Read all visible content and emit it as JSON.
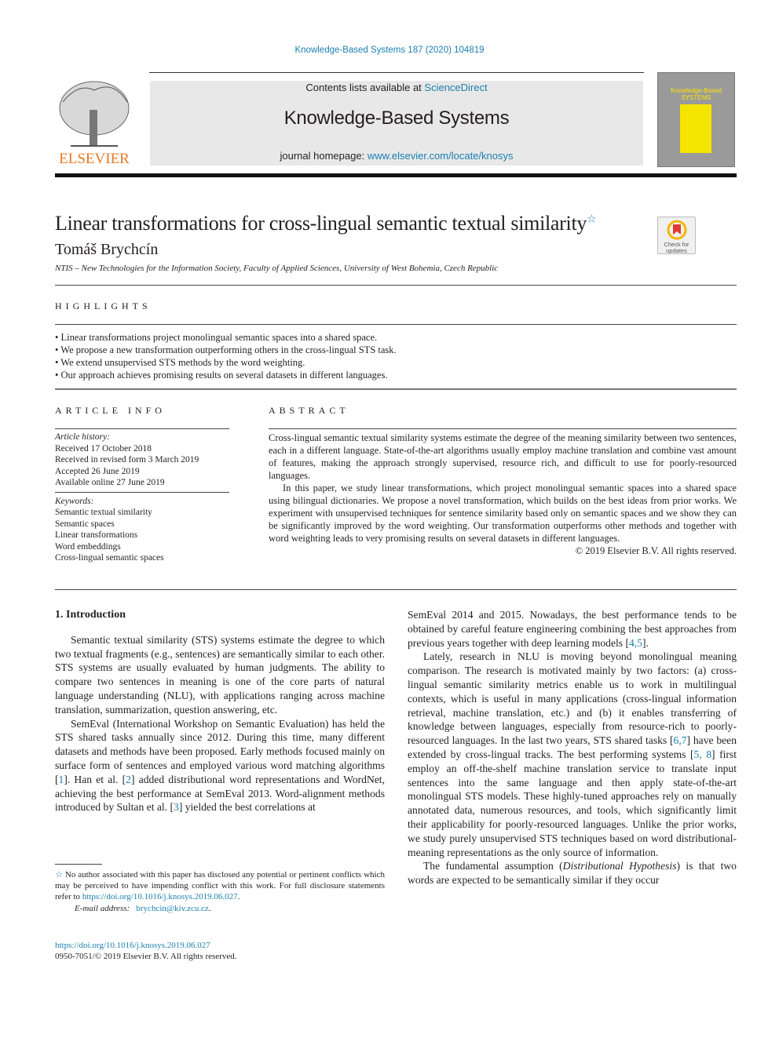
{
  "running_head": "Knowledge-Based Systems 187 (2020) 104819",
  "banner": {
    "contents_prefix": "Contents lists available at ",
    "contents_link": "ScienceDirect",
    "journal_title": "Knowledge-Based Systems",
    "homepage_prefix": "journal homepage: ",
    "homepage_link": "www.elsevier.com/locate/knosys",
    "publisher_logo": "ELSEVIER",
    "cover_title": "Knowledge-Based",
    "cover_subtitle": "SYSTEMS"
  },
  "article": {
    "title": "Linear transformations for cross-lingual semantic textual similarity",
    "title_mark": "☆",
    "author": "Tomáš Brychcín",
    "affiliation": "NTIS – New Technologies for the Information Society, Faculty of Applied Sciences, University of West Bohemia, Czech Republic",
    "check_updates": "Check for updates"
  },
  "highlights": {
    "heading": "HIGHLIGHTS",
    "items": [
      "Linear transformations project monolingual semantic spaces into a shared space.",
      "We propose a new transformation outperforming others in the cross-lingual STS task.",
      "We extend unsupervised STS methods by the word weighting.",
      "Our approach achieves promising results on several datasets in different languages."
    ]
  },
  "article_info": {
    "heading": "ARTICLE INFO",
    "history_label": "Article history:",
    "history": [
      "Received 17 October 2018",
      "Received in revised form 3 March 2019",
      "Accepted 26 June 2019",
      "Available online 27 June 2019"
    ],
    "keywords_label": "Keywords:",
    "keywords": [
      "Semantic textual similarity",
      "Semantic spaces",
      "Linear transformations",
      "Word embeddings",
      "Cross-lingual semantic spaces"
    ]
  },
  "abstract": {
    "heading": "ABSTRACT",
    "p1": "Cross-lingual semantic textual similarity systems estimate the degree of the meaning similarity between two sentences, each in a different language. State-of-the-art algorithms usually employ machine translation and combine vast amount of features, making the approach strongly supervised, resource rich, and difficult to use for poorly-resourced languages.",
    "p2": "In this paper, we study linear transformations, which project monolingual semantic spaces into a shared space using bilingual dictionaries. We propose a novel transformation, which builds on the best ideas from prior works. We experiment with unsupervised techniques for sentence similarity based only on semantic spaces and we show they can be significantly improved by the word weighting. Our transformation outperforms other methods and together with word weighting leads to very promising results on several datasets in different languages.",
    "copyright": "© 2019 Elsevier B.V. All rights reserved."
  },
  "intro": {
    "heading": "1.  Introduction",
    "left_p1": "Semantic textual similarity (STS) systems estimate the degree to which two textual fragments (e.g., sentences) are semantically similar to each other. STS systems are usually evaluated by human judgments. The ability to compare two sentences in meaning is one of the core parts of natural language understanding (NLU), with applications ranging across machine translation, summarization, question answering, etc.",
    "left_p2a": "SemEval (International Workshop on Semantic Evaluation) has held the STS shared tasks annually since 2012. During this time, many different datasets and methods have been proposed. Early methods focused mainly on surface form of sentences and employed various word matching algorithms [",
    "ref1": "1",
    "left_p2b": "]. Han et al. [",
    "ref2": "2",
    "left_p2c": "] added distributional word representations and WordNet, achieving the best performance at SemEval 2013. Word-alignment methods introduced by Sultan et al. [",
    "ref3": "3",
    "left_p2d": "] yielded the best correlations at",
    "right_p1a": "SemEval 2014 and 2015. Nowadays, the best performance tends to be obtained by careful feature engineering combining the best approaches from previous years together with deep learning models [",
    "ref45": "4,5",
    "right_p1b": "].",
    "right_p2a": "Lately, research in NLU is moving beyond monolingual meaning comparison. The research is motivated mainly by two factors: (a) cross-lingual semantic similarity metrics enable us to work in multilingual contexts, which is useful in many applications (cross-lingual information retrieval, machine translation, etc.) and (b) it enables transferring of knowledge between languages, especially from resource-rich to poorly-resourced languages. In the last two years, STS shared tasks [",
    "ref67": "6,7",
    "right_p2b": "] have been extended by cross-lingual tracks. The best performing systems [",
    "ref58": "5, 8",
    "right_p2c": "] first employ an off-the-shelf machine translation service to translate input sentences into the same language and then apply state-of-the-art monolingual STS models. These highly-tuned approaches rely on manually annotated data, numerous resources, and tools, which significantly limit their applicability for poorly-resourced languages. Unlike the prior works, we study purely unsupervised STS techniques based on word distributional-meaning representations as the only source of information.",
    "right_p3a": "The fundamental assumption (",
    "right_p3_em": "Distributional Hypothesis",
    "right_p3b": ") is that two words are expected to be semantically similar if they occur"
  },
  "footnote": {
    "mark": "☆",
    "text": " No author associated with this paper has disclosed any potential or pertinent conflicts which may be perceived to have impending conflict with this work. For full disclosure statements refer to ",
    "link": "https://doi.org/10.1016/j.knosys.2019.06.027",
    "email_label": "E-mail address:",
    "email": "brychcin@kiv.zcu.cz"
  },
  "bottom": {
    "doi": "https://doi.org/10.1016/j.knosys.2019.06.027",
    "issn": "0950-7051/© 2019 Elsevier B.V. All rights reserved."
  }
}
